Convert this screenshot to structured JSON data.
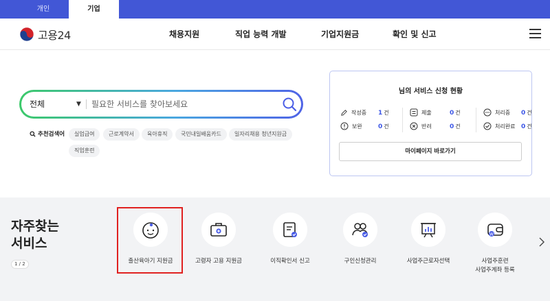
{
  "top_tabs": {
    "personal": "개인",
    "business": "기업"
  },
  "header": {
    "logo_text": "고용24",
    "nav": [
      "채용지원",
      "직업 능력 개발",
      "기업지원금",
      "확인 및 신고"
    ]
  },
  "search": {
    "scope": "전체",
    "placeholder": "필요한 서비스를 찾아보세요"
  },
  "recommended": {
    "label": "추천검색어",
    "keywords": [
      "실업급여",
      "근로계약서",
      "육아휴직",
      "국민내일배움카드",
      "일자리채용 청년지원금",
      "직업훈련"
    ]
  },
  "status_panel": {
    "title": "님의 서비스 신청 현황",
    "items": [
      {
        "label": "작성중",
        "count": "1",
        "unit": "건"
      },
      {
        "label": "제출",
        "count": "0",
        "unit": "건"
      },
      {
        "label": "처리중",
        "count": "0",
        "unit": "건"
      },
      {
        "label": "보완",
        "count": "0",
        "unit": "건"
      },
      {
        "label": "반려",
        "count": "0",
        "unit": "건"
      },
      {
        "label": "처리완료",
        "count": "0",
        "unit": "건"
      }
    ],
    "mypage_button": "마이페이지 바로가기"
  },
  "frequent": {
    "title_line1": "자주찾는",
    "title_line2": "서비스",
    "pager": "1 / 2",
    "services": [
      {
        "label": "출산육아기 지원금",
        "icon": "baby-icon"
      },
      {
        "label": "고령자 고용 지원금",
        "icon": "briefcase-plus-icon"
      },
      {
        "label": "이직확인서 신고",
        "icon": "document-check-icon"
      },
      {
        "label": "구인신청관리",
        "icon": "people-check-icon"
      },
      {
        "label": "사업주근로자선택",
        "icon": "presentation-board-icon"
      },
      {
        "label": "사업주훈련",
        "label2": "사업주계좌 등록",
        "icon": "wallet-icon"
      }
    ]
  },
  "colors": {
    "brand_blue": "#4257d6",
    "accent_blue": "#3b55e6",
    "highlight_red": "#e0201f"
  }
}
